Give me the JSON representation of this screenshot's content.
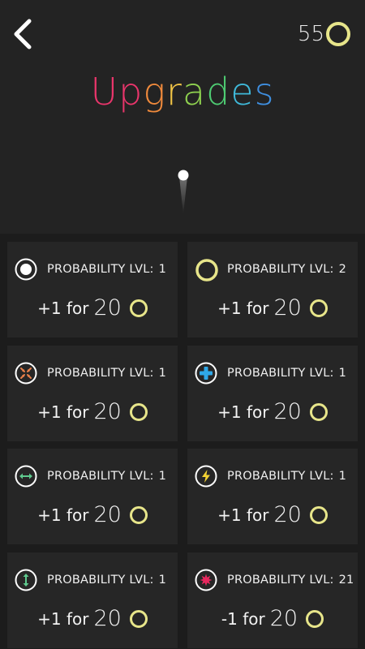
{
  "header": {
    "coin_count": "55",
    "title_letters": [
      {
        "ch": "U",
        "color": "#e9356b"
      },
      {
        "ch": "p",
        "color": "#e9356b"
      },
      {
        "ch": "g",
        "color": "#f08a3c"
      },
      {
        "ch": "r",
        "color": "#f3c646"
      },
      {
        "ch": "a",
        "color": "#8fd14f"
      },
      {
        "ch": "d",
        "color": "#4ecb72"
      },
      {
        "ch": "e",
        "color": "#3fb8d8"
      },
      {
        "ch": "s",
        "color": "#3f8fe0"
      }
    ]
  },
  "upgrades": [
    {
      "icon": "white-dot-icon",
      "label": "PROBABILITY LVL:",
      "level": "1",
      "price_text": "+1 for",
      "price_amount": "20"
    },
    {
      "icon": "yellow-ring-icon",
      "label": "PROBABILITY LVL:",
      "level": "2",
      "price_text": "+1 for",
      "price_amount": "20"
    },
    {
      "icon": "shrink-arrows-icon",
      "label": "PROBABILITY LVL:",
      "level": "1",
      "price_text": "+1 for",
      "price_amount": "20"
    },
    {
      "icon": "blue-plus-icon",
      "label": "PROBABILITY LVL:",
      "level": "1",
      "price_text": "+1 for",
      "price_amount": "20"
    },
    {
      "icon": "horizontal-arrows-icon",
      "label": "PROBABILITY LVL:",
      "level": "1",
      "price_text": "+1 for",
      "price_amount": "20"
    },
    {
      "icon": "lightning-icon",
      "label": "PROBABILITY LVL:",
      "level": "1",
      "price_text": "+1 for",
      "price_amount": "20"
    },
    {
      "icon": "vertical-arrows-icon",
      "label": "PROBABILITY LVL:",
      "level": "1",
      "price_text": "+1 for",
      "price_amount": "20"
    },
    {
      "icon": "red-burst-icon",
      "label": "PROBABILITY LVL:",
      "level": "21",
      "price_text": "-1 for",
      "price_amount": "20"
    }
  ],
  "colors": {
    "coin": "#e7e58a",
    "card_bg": "#262626",
    "page_bg": "#1c1c1c",
    "header_bg": "#232323"
  }
}
